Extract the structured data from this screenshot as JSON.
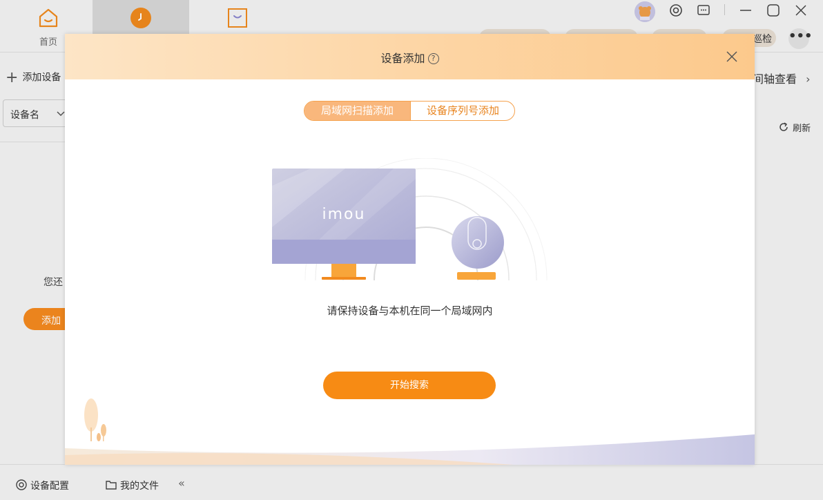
{
  "nav": {
    "home_label": "首页",
    "playback_label": "",
    "message_label": ""
  },
  "toolbar": {
    "patrol_label": "巡检",
    "more_label": "•••"
  },
  "sidebar": {
    "add_device_label": "添加设备",
    "device_name_select": "设备名",
    "empty_text": "您还",
    "add_button_label": "添加"
  },
  "main": {
    "timeline_label": "间轴查看",
    "refresh_label": "刷新"
  },
  "bottom": {
    "device_config_label": "设备配置",
    "my_files_label": "我的文件",
    "collapse_label": "«"
  },
  "modal": {
    "title": "设备添加",
    "help_symbol": "?",
    "tabs": [
      {
        "label": "局域网扫描添加",
        "active": true
      },
      {
        "label": "设备序列号添加",
        "active": false
      }
    ],
    "brand_logo": "imou",
    "instruction": "请保持设备与本机在同一个局域网内",
    "start_button_label": "开始搜索"
  },
  "colors": {
    "accent": "#f78b14",
    "header_gradient_start": "#fde5c6",
    "header_gradient_end": "#fcc98c",
    "tab_active_bg": "#f9b77c"
  },
  "icons": {
    "home": "home-icon",
    "playback": "clock-icon",
    "message": "message-icon",
    "settings": "settings-icon",
    "feedback": "feedback-icon",
    "minimize": "minimize-icon",
    "maximize": "maximize-icon",
    "close": "close-icon",
    "refresh": "refresh-icon",
    "device_config": "gear-icon",
    "my_files": "folder-icon",
    "help": "help-icon"
  }
}
